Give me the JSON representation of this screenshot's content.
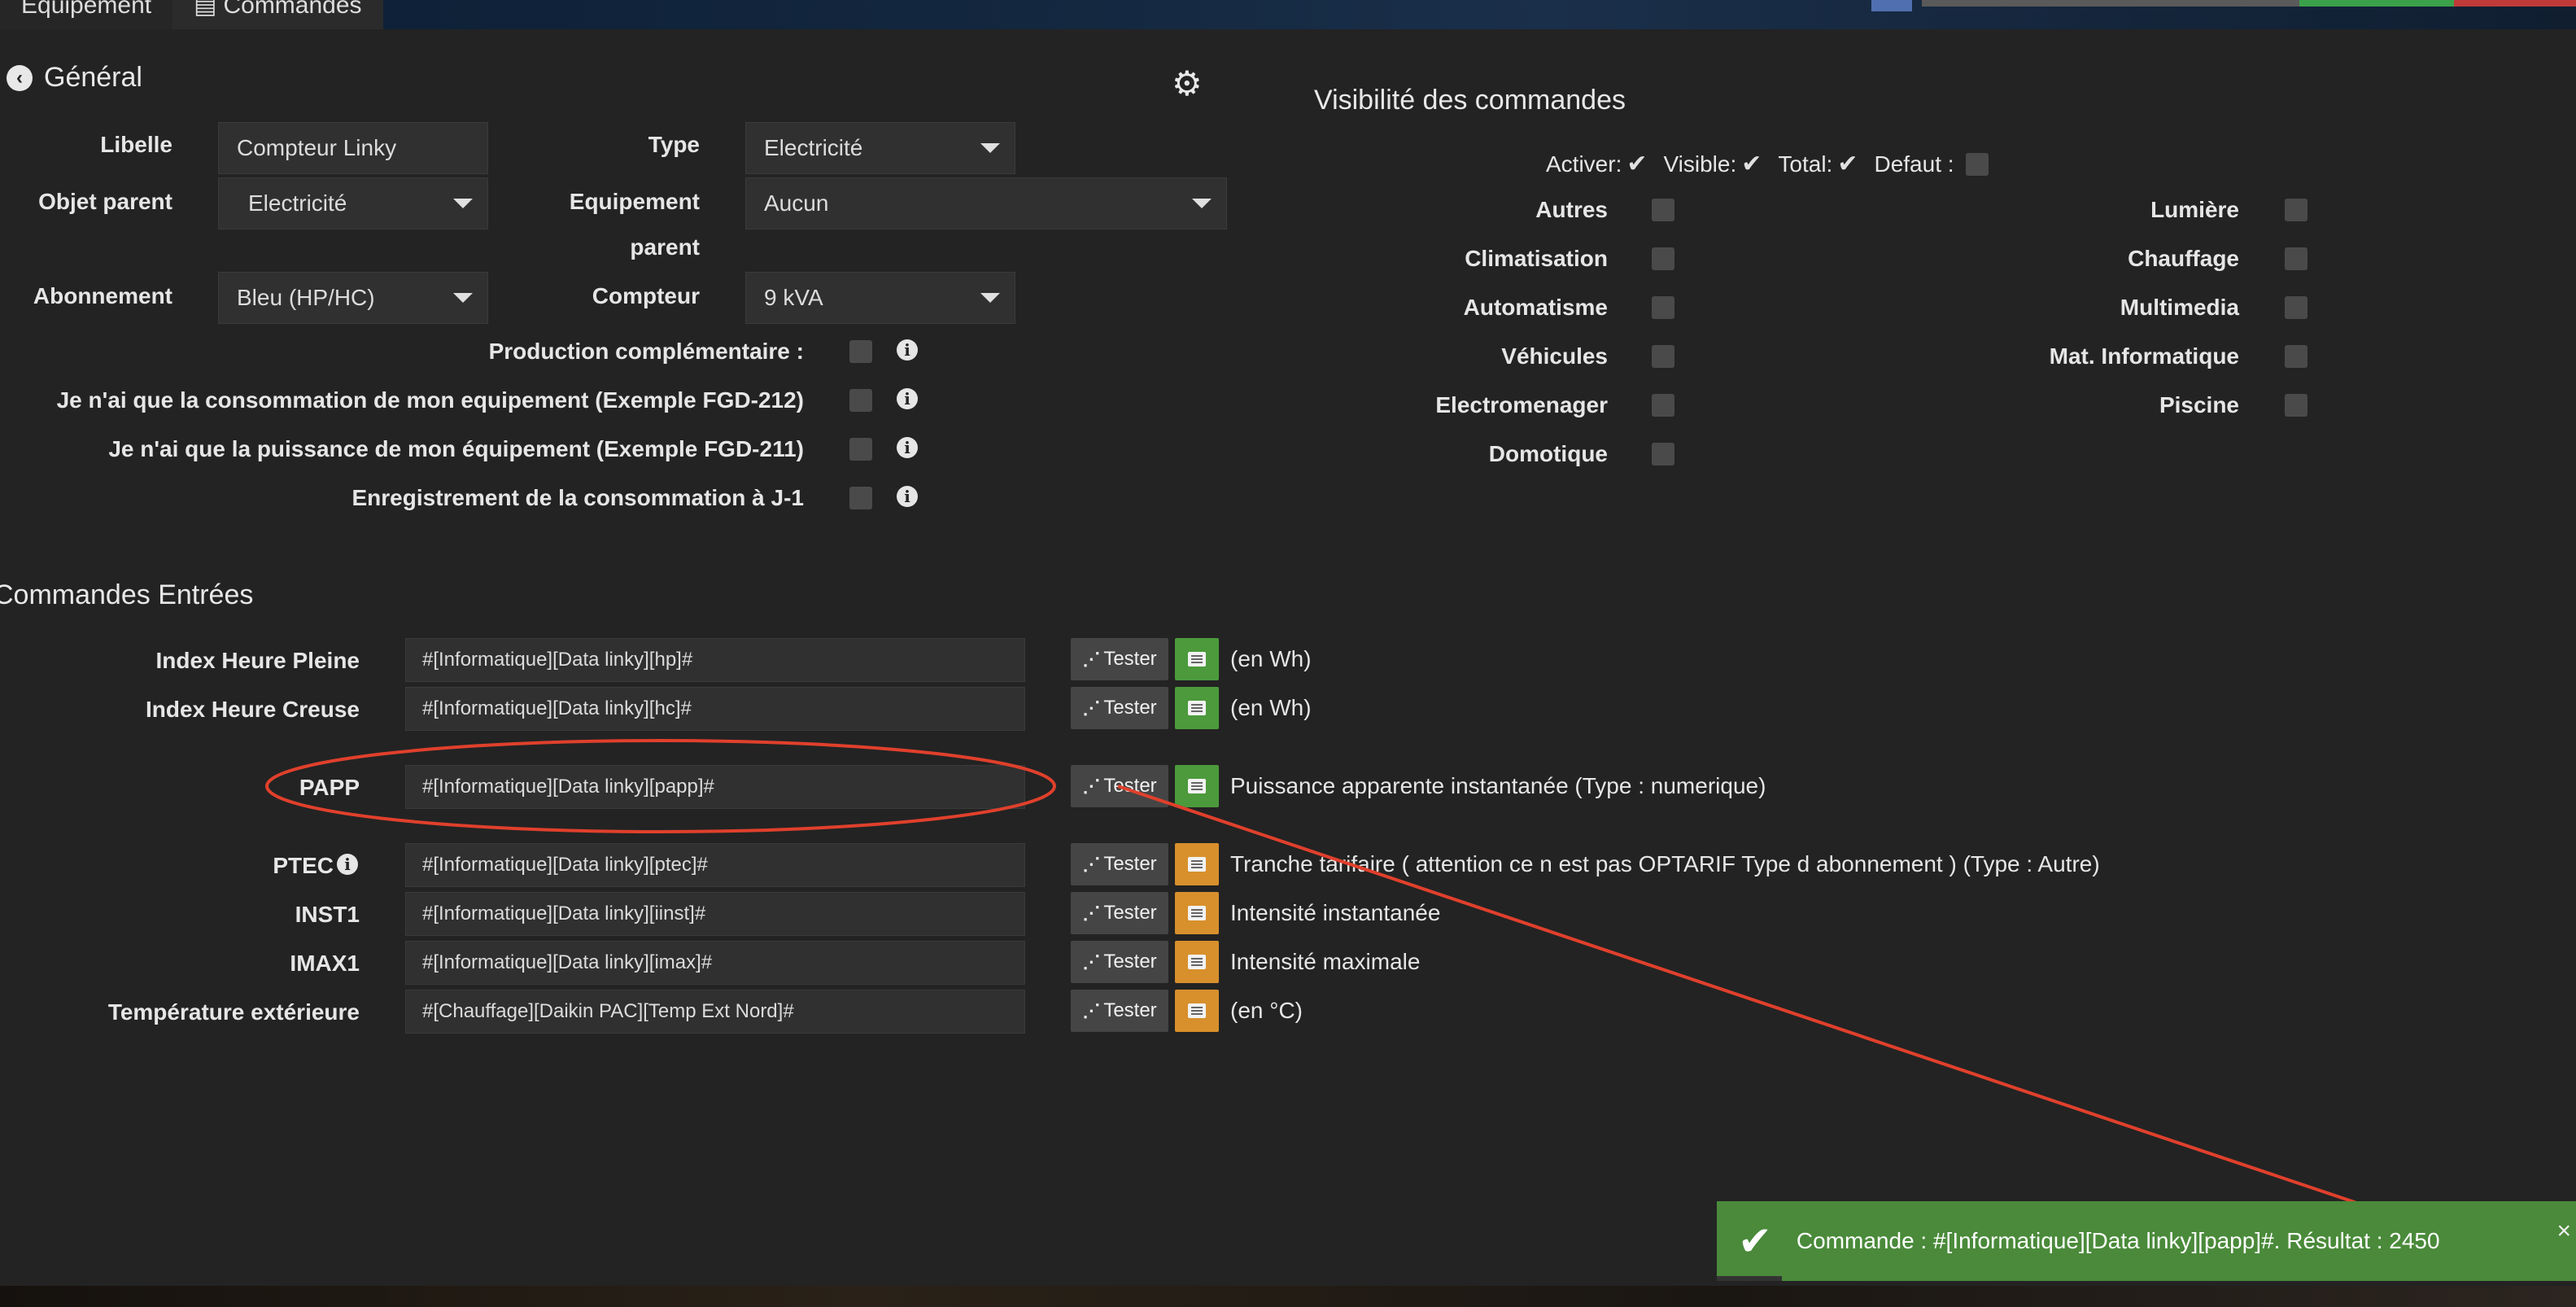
{
  "tabs": [
    "Équipement",
    "Commandes"
  ],
  "general": {
    "title": "Général",
    "libelle_label": "Libelle",
    "libelle_value": "Compteur Linky",
    "type_label": "Type",
    "type_value": "Electricité",
    "objet_parent_label": "Objet parent",
    "objet_parent_value": "Electricité",
    "equipement_parent_label_1": "Equipement",
    "equipement_parent_label_2": "parent",
    "equipement_parent_value": "Aucun",
    "abonnement_label": "Abonnement",
    "abonnement_value": "Bleu (HP/HC)",
    "compteur_label": "Compteur",
    "compteur_value": "9 kVA",
    "options": [
      "Production complémentaire :",
      "Je n'ai que la consommation de mon equipement (Exemple FGD-212)",
      "Je n'ai que la puissance de mon équipement (Exemple FGD-211)",
      "Enregistrement de la consommation à J-1"
    ]
  },
  "visibility": {
    "title": "Visibilité des commandes",
    "activer": "Activer:",
    "visible": "Visible:",
    "total": "Total:",
    "defaut": "Defaut :",
    "left": [
      "Autres",
      "Climatisation",
      "Automatisme",
      "Véhicules",
      "Electromenager",
      "Domotique"
    ],
    "right": [
      "Lumière",
      "Chauffage",
      "Multimedia",
      "Mat. Informatique",
      "Piscine"
    ]
  },
  "commands": {
    "title": "Commandes Entrées",
    "tester": "Tester",
    "rows": [
      {
        "label": "Index Heure Pleine",
        "value": "#[Informatique][Data linky][hp]#",
        "desc": "(en Wh)"
      },
      {
        "label": "Index Heure Creuse",
        "value": "#[Informatique][Data linky][hc]#",
        "desc": "(en Wh)"
      },
      {
        "label": "PAPP",
        "value": "#[Informatique][Data linky][papp]#",
        "desc": "Puissance apparente instantanée (Type : numerique)"
      },
      {
        "label": "PTEC",
        "value": "#[Informatique][Data linky][ptec]#",
        "desc": "Tranche tarifaire ( attention ce n est pas OPTARIF Type d abonnement ) (Type : Autre)"
      },
      {
        "label": "INST1",
        "value": "#[Informatique][Data linky][iinst]#",
        "desc": "Intensité instantanée"
      },
      {
        "label": "IMAX1",
        "value": "#[Informatique][Data linky][imax]#",
        "desc": "Intensité maximale"
      },
      {
        "label": "Température extérieure",
        "value": "#[Chauffage][Daikin PAC][Temp Ext Nord]#",
        "desc": "(en °C)"
      }
    ]
  },
  "toast": {
    "message": "Commande : #[Informatique][Data linky][papp]#. Résultat : 2450"
  },
  "colors": {
    "annotation": "#e0402c",
    "success": "#4a8a3a",
    "history_green": "#4c9a3c",
    "history_orange": "#d8902c"
  },
  "icons": {
    "back": "arrow-circle-left-icon",
    "settings": "gears-icon",
    "tester": "rss-icon",
    "history": "list-alt-icon",
    "toast": "check-icon"
  }
}
